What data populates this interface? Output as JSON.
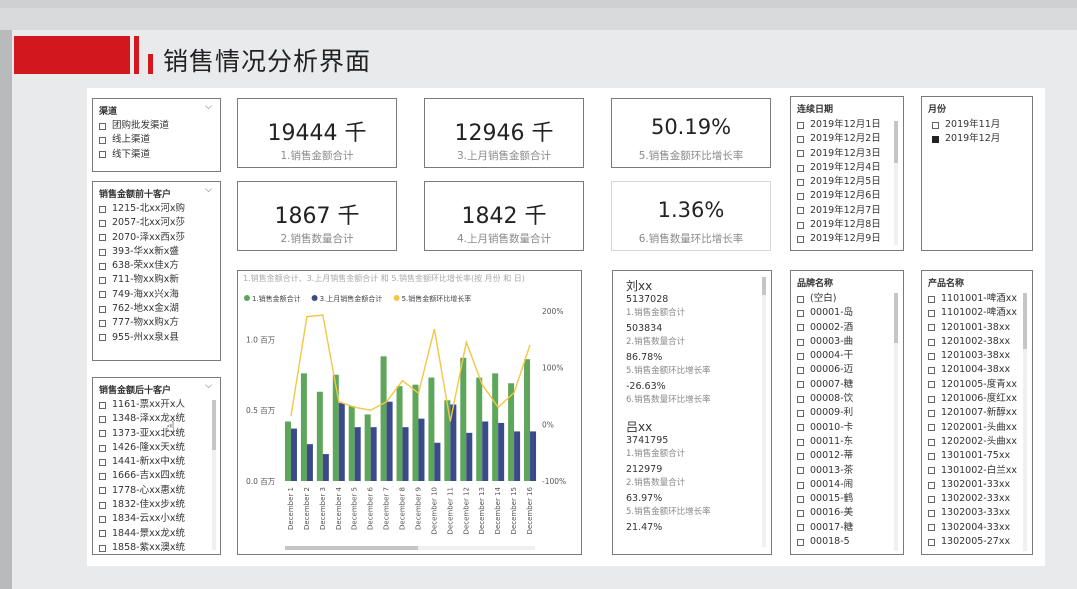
{
  "page": {
    "title": "销售情况分析界面",
    "accent_color": "#d3171e"
  },
  "channel_slicer": {
    "title": "渠道",
    "items": [
      "团购批发渠道",
      "线上渠道",
      "线下渠道"
    ]
  },
  "top10_slicer": {
    "title": "销售金额前十客户",
    "items": [
      "1215-北xx河x购",
      "2057-北xx河x莎",
      "2070-泽xx西x莎",
      "393-华xx新x盛",
      "638-荣xx佳x方",
      "711-物xx购x新",
      "749-海xx兴x海",
      "762-地xx金x湖",
      "777-物xx购x方",
      "955-州xx泉x县"
    ]
  },
  "bottom10_slicer": {
    "title": "销售金额后十客户",
    "items": [
      "1161-票xx开x人",
      "1348-泽xx龙x统",
      "1373-亚xx北x统",
      "1426-隆xx天x统",
      "1441-新xx中x统",
      "1666-吉xx四x统",
      "1778-心xx惠x统",
      "1832-佳xx步x统",
      "1834-云xx小x统",
      "1844-景xx龙x统",
      "1858-紫xx澳x统"
    ]
  },
  "cards": [
    {
      "value": "19444 千",
      "label": "1.销售金额合计"
    },
    {
      "value": "12946 千",
      "label": "3.上月销售金额合计"
    },
    {
      "value": "50.19%",
      "label": "5.销售金额环比增长率"
    },
    {
      "value": "1867 千",
      "label": "2.销售数量合计"
    },
    {
      "value": "1842 千",
      "label": "4.上月销售数量合计"
    },
    {
      "value": "1.36%",
      "label": "6.销售数量环比增长率"
    }
  ],
  "date_slicer": {
    "title": "连续日期",
    "items": [
      "2019年12月1日",
      "2019年12月2日",
      "2019年12月3日",
      "2019年12月4日",
      "2019年12月5日",
      "2019年12月6日",
      "2019年12月7日",
      "2019年12月8日",
      "2019年12月9日"
    ]
  },
  "month_slicer": {
    "title": "月份",
    "items": [
      {
        "label": "2019年11月",
        "checked": false
      },
      {
        "label": "2019年12月",
        "checked": true
      }
    ]
  },
  "chart_data": {
    "type": "bar",
    "title": "1.销售金额合计、3.上月销售金额合计 和 5.销售金额环比增长率(按 月份 和 日)",
    "categories": [
      "December 1",
      "December 2",
      "December 3",
      "December 4",
      "December 5",
      "December 6",
      "December 7",
      "December 8",
      "December 9",
      "December 10",
      "December 11",
      "December 12",
      "December 13",
      "December 14",
      "December 15",
      "December 16"
    ],
    "series": [
      {
        "name": "1.销售金额合计",
        "kind": "bar",
        "axis": "left",
        "color": "#5ea65b",
        "values": [
          0.42,
          0.76,
          0.63,
          0.75,
          0.53,
          0.47,
          0.88,
          0.67,
          0.68,
          0.73,
          0.57,
          0.87,
          0.73,
          0.76,
          0.69,
          0.86
        ]
      },
      {
        "name": "3.上月销售金额合计",
        "kind": "bar",
        "axis": "left",
        "color": "#3a4a8a",
        "values": [
          0.37,
          0.26,
          0.19,
          0.55,
          0.38,
          0.38,
          0.56,
          0.38,
          0.44,
          0.27,
          0.54,
          0.34,
          0.42,
          0.41,
          0.35,
          0.35
        ]
      },
      {
        "name": "5.销售金额环比增长率",
        "kind": "line",
        "axis": "right",
        "color": "#f2c744",
        "values": [
          0.15,
          1.9,
          1.93,
          0.4,
          0.3,
          0.25,
          0.4,
          0.77,
          0.55,
          1.68,
          0.05,
          1.45,
          0.7,
          0.3,
          0.56,
          1.4
        ]
      }
    ],
    "left_axis": {
      "ticks": [
        "0.0 百万",
        "0.5 百万",
        "1.0 百万"
      ],
      "ylim": [
        0,
        1.2
      ]
    },
    "right_axis": {
      "ticks": [
        "-100%",
        "0%",
        "100%",
        "200%"
      ],
      "ylim": [
        -1.0,
        2.0
      ]
    }
  },
  "people": [
    {
      "name": "刘xx",
      "rows": [
        {
          "value": "5137028",
          "label": "1.销售金额合计"
        },
        {
          "value": "503834",
          "label": "2.销售数量合计"
        },
        {
          "value": "86.78%",
          "label": "5.销售金额环比增长率"
        },
        {
          "value": "-26.63%",
          "label": "6.销售数量环比增长率"
        }
      ]
    },
    {
      "name": "吕xx",
      "rows": [
        {
          "value": "3741795",
          "label": "1.销售金额合计"
        },
        {
          "value": "212979",
          "label": "2.销售数量合计"
        },
        {
          "value": "63.97%",
          "label": "5.销售金额环比增长率"
        },
        {
          "value": "21.47%",
          "label": ""
        }
      ]
    }
  ],
  "brand_slicer": {
    "title": "品牌名称",
    "items": [
      "(空白)",
      "00001-岛",
      "00002-酒",
      "00003-曲",
      "00004-干",
      "00006-迈",
      "00007-糖",
      "00008-饮",
      "00009-利",
      "00010-卡",
      "00011-东",
      "00012-蒂",
      "00013-茶",
      "00014-闹",
      "00015-鹤",
      "00016-美",
      "00017-糖",
      "00018-5"
    ]
  },
  "product_slicer": {
    "title": "产品名称",
    "items": [
      "1101001-啤酒xx",
      "1101002-啤酒xx",
      "1201001-38xx",
      "1201002-38xx",
      "1201003-38xx",
      "1201004-38xx",
      "1201005-度青xx",
      "1201006-度红xx",
      "1201007-新醇xx",
      "1202001-头曲xx",
      "1202002-头曲xx",
      "1301001-75xx",
      "1301002-白兰xx",
      "1302001-33xx",
      "1302002-33xx",
      "1302003-33xx",
      "1302004-33xx",
      "1302005-27xx"
    ]
  }
}
